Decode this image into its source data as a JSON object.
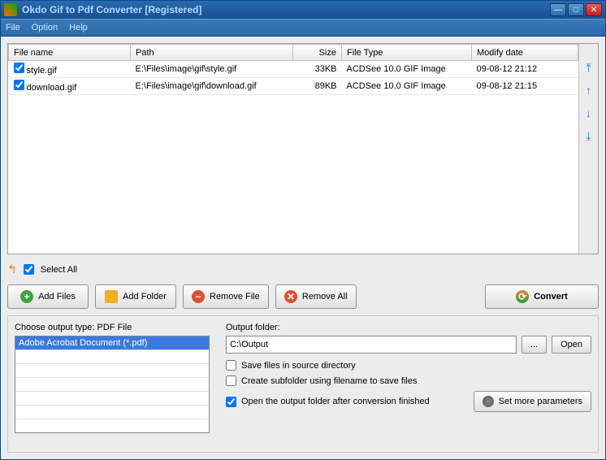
{
  "window": {
    "title": "Okdo Gif to Pdf Converter [Registered]"
  },
  "menu": {
    "file": "File",
    "option": "Option",
    "help": "Help"
  },
  "columns": {
    "name": "File name",
    "path": "Path",
    "size": "Size",
    "type": "File Type",
    "date": "Modify date"
  },
  "files": [
    {
      "checked": true,
      "name": "style.gif",
      "path": "E:\\Files\\image\\gif\\style.gif",
      "size": "33KB",
      "type": "ACDSee 10.0 GIF Image",
      "date": "09-08-12 21:12"
    },
    {
      "checked": true,
      "name": "download.gif",
      "path": "E:\\Files\\image\\gif\\download.gif",
      "size": "89KB",
      "type": "ACDSee 10.0 GIF Image",
      "date": "09-08-12 21:15"
    }
  ],
  "selectall": {
    "label": "Select All",
    "checked": true
  },
  "toolbar": {
    "addfiles": "Add Files",
    "addfolder": "Add Folder",
    "removefile": "Remove File",
    "removeall": "Remove All",
    "convert": "Convert"
  },
  "output": {
    "type_label": "Choose output type:",
    "type_value": "PDF File",
    "type_item": "Adobe Acrobat Document (*.pdf)",
    "folder_label": "Output folder:",
    "folder_value": "C:\\Output",
    "browse": "...",
    "open": "Open",
    "save_source": {
      "label": "Save files in source directory",
      "checked": false
    },
    "subfolder": {
      "label": "Create subfolder using filename to save files",
      "checked": false
    },
    "openafter": {
      "label": "Open the output folder after conversion finished",
      "checked": true
    },
    "more": "Set more parameters"
  }
}
